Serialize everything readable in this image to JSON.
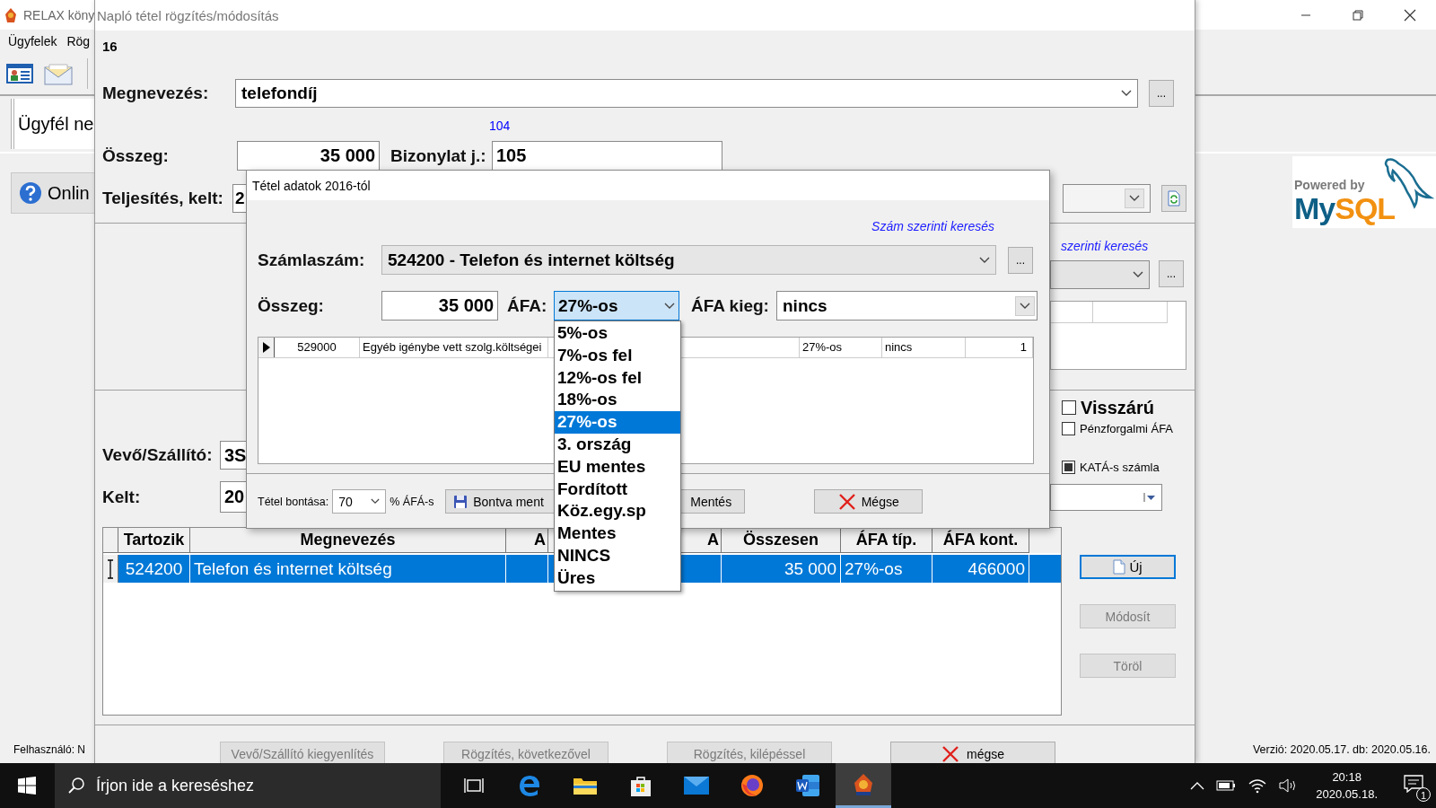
{
  "app_window": {
    "title": "RELAX köny",
    "menu": [
      "Ügyfelek",
      "Rög"
    ],
    "customer_label": "Ügyfél ne",
    "online_button": "Onlin",
    "logo_tagline": "Powered by",
    "logo_word_a": "My",
    "logo_word_b": "SQL",
    "status_left": "Felhasználó: N",
    "status_right": "Verzió: 2020.05.17. db: 2020.05.16."
  },
  "entry_dialog": {
    "title": "Napló tétel rögzítés/módosítás",
    "record_number": "16",
    "name": {
      "label": "Megnevezés:",
      "value": "telefondíj",
      "browse": "..."
    },
    "reference_hint": "104",
    "amount": {
      "label": "Összeg:",
      "value": "35 000"
    },
    "voucher": {
      "label": "Bizonylat j.:",
      "value": "105"
    },
    "date": {
      "label": "Teljesítés, kelt:",
      "value": "2"
    },
    "search_link": "szerinti keresés",
    "side_browse": "...",
    "checkboxes": [
      {
        "label": "Visszárú",
        "checked": false,
        "kind": "large"
      },
      {
        "label": "Pénzforgalmi ÁFA",
        "checked": false,
        "kind": "small"
      },
      {
        "label": "KATÁ-s számla",
        "checked": true,
        "kind": "small"
      }
    ],
    "partner": {
      "label": "Vevő/Szállító:",
      "value": "3S"
    },
    "issued": {
      "label": "Kelt:",
      "value": "20"
    },
    "table": {
      "columns": [
        "Tartozik",
        "Megnevezés",
        "A",
        "A",
        "Összesen",
        "ÁFA típ.",
        "ÁFA kont."
      ],
      "rows": [
        {
          "selected": true,
          "account": "524200",
          "name": "Telefon és internet költség",
          "total": "35 000",
          "vat_type": "27%-os",
          "vat_account": "466000"
        }
      ]
    },
    "side_buttons": [
      {
        "label": "Új",
        "disabled": false,
        "kind": "new"
      },
      {
        "label": "Módosít",
        "disabled": true,
        "kind": "plain"
      },
      {
        "label": "Töröl",
        "disabled": true,
        "kind": "plain"
      }
    ],
    "bottom_buttons": [
      {
        "label": "Vevő/Szállító kiegyenlítés",
        "disabled": true,
        "kind": "plain"
      },
      {
        "label": "Rögzítés, következővel",
        "disabled": true,
        "kind": "plain"
      },
      {
        "label": "Rögzítés, kilépéssel",
        "disabled": true,
        "kind": "plain"
      },
      {
        "label": "mégse",
        "disabled": false,
        "kind": "cancel"
      }
    ]
  },
  "item_dialog": {
    "title": "Tétel adatok 2016-tól",
    "search_link": "Szám szerinti keresés",
    "account": {
      "label": "Számlaszám:",
      "value": "524200 - Telefon és internet költség",
      "browse": "..."
    },
    "amount": {
      "label": "Összeg:",
      "value": "35 000"
    },
    "vat": {
      "label": "ÁFA:",
      "value": "27%-os",
      "expanded": true,
      "options": [
        {
          "label": "5%-os",
          "selected": false
        },
        {
          "label": "7%-os fel",
          "selected": false
        },
        {
          "label": "12%-os fel",
          "selected": false
        },
        {
          "label": "18%-os",
          "selected": false
        },
        {
          "label": "27%-os",
          "selected": true
        },
        {
          "label": "3. ország",
          "selected": false
        },
        {
          "label": "EU mentes",
          "selected": false
        },
        {
          "label": "Fordított",
          "selected": false
        },
        {
          "label": "Köz.egy.sp",
          "selected": false
        },
        {
          "label": "Mentes",
          "selected": false
        },
        {
          "label": "NINCS",
          "selected": false
        },
        {
          "label": "Üres",
          "selected": false
        }
      ]
    },
    "vat_extra": {
      "label": "ÁFA kieg:",
      "value": "nincs"
    },
    "rows": [
      {
        "current": true,
        "account": "529000",
        "name": "Egyéb igénybe vett szolg.költségei",
        "vat_type": "27%-os",
        "vat_extra": "nincs",
        "count": "1"
      }
    ],
    "split": {
      "label": "Tétel bontása:",
      "value": "70",
      "suffix": "% ÁFÁ-s"
    },
    "buttons": [
      {
        "label": "Bontva ment",
        "kind": "save"
      },
      {
        "label": "Mentés",
        "kind": "plain"
      },
      {
        "label": "Mégse",
        "kind": "cancel"
      }
    ]
  },
  "taskbar": {
    "search_placeholder": "Írjon ide a kereséshez",
    "apps": [
      {
        "kind": "taskview",
        "active": false
      },
      {
        "kind": "browser",
        "active": false
      },
      {
        "kind": "folder",
        "active": false
      },
      {
        "kind": "store",
        "active": false
      },
      {
        "kind": "mail",
        "active": false
      },
      {
        "kind": "fox",
        "active": false
      },
      {
        "kind": "word",
        "active": false
      },
      {
        "kind": "relax",
        "active": true
      }
    ],
    "time": "20:18",
    "date": "2020.05.18.",
    "notifications": "1"
  }
}
